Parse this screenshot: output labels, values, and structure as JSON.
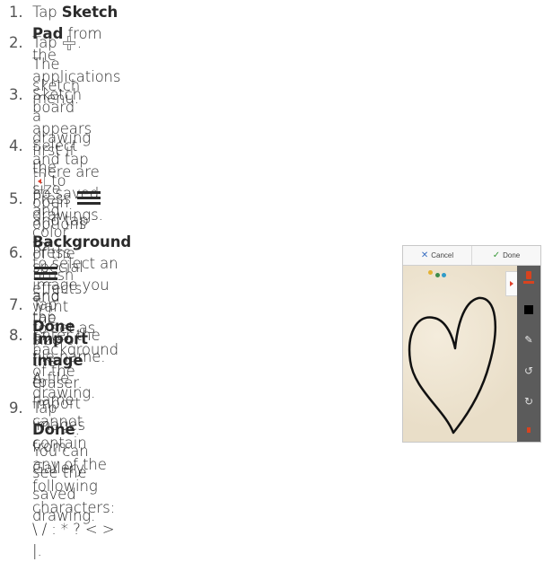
{
  "steps": [
    {
      "num": "1.",
      "pre": "Tap ",
      "bold": "Sketch Pad",
      "post": " from the applications menu."
    },
    {
      "num": "2.",
      "pre": "Tap ",
      "icon": "plus-icon",
      "post": ". The sketch board appears first if there are no saved",
      "line2": "drawings."
    },
    {
      "num": "3.",
      "pre": "Sketch a drawing and tap ",
      "icon": "side-tab-arrow-icon",
      "post": " to open options for special",
      "line2": "effects."
    },
    {
      "num": "4.",
      "line1": "Select the size and color of the brush and the size of the",
      "line2": "eraser."
    },
    {
      "num": "5.",
      "pre": "Press ",
      "icon": "menu-icon",
      "mid": " and tap ",
      "bold": "Background",
      "post": " to select an image you want",
      "line2": "to set as background of the drawing."
    },
    {
      "num": "6.",
      "pre": "Press ",
      "icon": "menu-icon",
      "mid": " and tap ",
      "bold": "Import image",
      "post": " to",
      "line2": "import images from Gallery."
    },
    {
      "num": "7.",
      "pre": "Tap ",
      "bold": "Done",
      "post": "."
    },
    {
      "num": "8.",
      "line1": "Enter the file name. A file name",
      "line2": "cannot contain any of the following",
      "line3": "characters: \\ / : * ? < > |."
    },
    {
      "num": "9.",
      "pre": "Tap ",
      "bold": "Done",
      "post": ". You can see the saved",
      "line2": "drawing."
    }
  ],
  "phone": {
    "cancel_label": "Cancel",
    "done_label": "Done",
    "cancel_icon": "x-icon",
    "done_icon": "check-icon",
    "dot_colors": [
      "#e4b233",
      "#3c8d4c",
      "#2f9bc9"
    ],
    "heart_color": "#111111",
    "brush_color": "#d8431f",
    "selected_color": "#000000"
  }
}
